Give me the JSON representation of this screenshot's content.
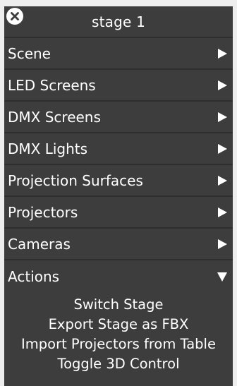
{
  "panel": {
    "title": "stage 1",
    "close_icon": "close-circle-icon"
  },
  "menu": {
    "items": [
      {
        "label": "Scene",
        "icon": "chevron-right-icon"
      },
      {
        "label": "LED Screens",
        "icon": "chevron-right-icon"
      },
      {
        "label": "DMX Screens",
        "icon": "chevron-right-icon"
      },
      {
        "label": "DMX Lights",
        "icon": "chevron-right-icon"
      },
      {
        "label": "Projection Surfaces",
        "icon": "chevron-right-icon"
      },
      {
        "label": "Projectors",
        "icon": "chevron-right-icon"
      },
      {
        "label": "Cameras",
        "icon": "chevron-right-icon"
      }
    ],
    "actions": {
      "label": "Actions",
      "icon": "chevron-down-icon",
      "expanded": true,
      "items": [
        "Switch Stage",
        "Export Stage as FBX",
        "Import Projectors from Table",
        "Toggle 3D Control"
      ]
    }
  },
  "colors": {
    "panel_bg": "#3d3d3d",
    "divider": "#2e2e2e",
    "text": "#ffffff",
    "page_bg": "#eeeeee"
  }
}
